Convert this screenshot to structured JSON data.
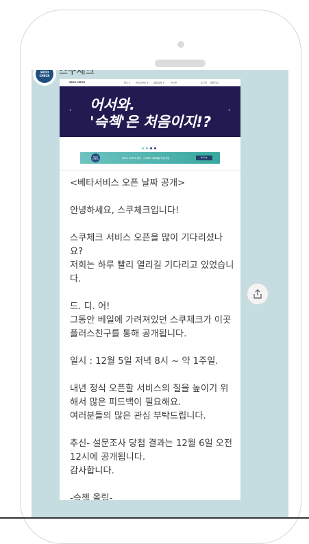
{
  "chat": {
    "sender_name": "스쿠체크",
    "avatar_text": "SKOO CHECK"
  },
  "site": {
    "logo": "SKOO CHECK",
    "menu": [
      "협수 ▾",
      "학사/서비스 ▾",
      "일정/일정 ▾",
      "커시판",
      "로그인",
      "회원가입"
    ]
  },
  "hero": {
    "line1": "어서와.",
    "line2": "'슥첵'은 처음이지!?"
  },
  "banner": {
    "logo_text": "SKOO CHECK",
    "text": "SKOO CHECK 일자 · 스쿠체크 무료체험 학생 모집",
    "button": "원하기 ▶"
  },
  "message": [
    "<베타서비스 오픈 날짜 공개>",
    "안녕하세요, 스쿠체크입니다!",
    "스쿠체크 서비스 오픈을 많이 기다리셨나요?\n저희는 하루 빨리 열리길 기다리고 있었습니다.",
    "드. 디. 어!\n그동안 베일에 가려져있던 스쿠체크가 이곳 플러스친구를 통해 공개됩니다.",
    "일시 : 12월 5일 저녁  8시 ~ 약 1주일.",
    "내년 정식 오픈할 서비스의 질을 높이기 위해서 많은 피드백이 필요해요.\n여러분들의 많은 관심 부탁드립니다.",
    "추신-  설문조사 당첨 결과는 12월 6일 오전 12시에 공개됩니다.\n감사합니다.",
    "-슥첵 올림-"
  ],
  "colors": {
    "chat_background": "#c5dde0",
    "hero_background": "#241a52",
    "banner_accent": "#37a89f"
  },
  "icons": {
    "share": "share-icon"
  }
}
